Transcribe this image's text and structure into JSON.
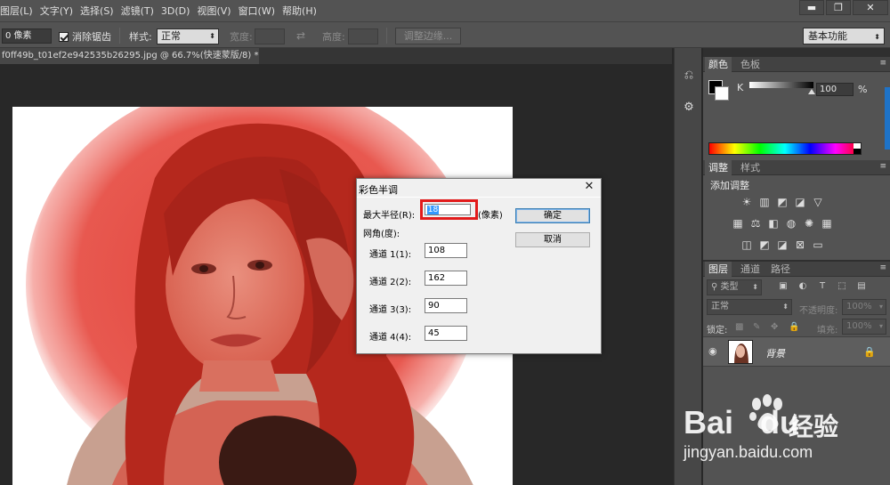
{
  "menu": [
    "图层(L)",
    "文字(Y)",
    "选择(S)",
    "滤镜(T)",
    "3D(D)",
    "视图(V)",
    "窗口(W)",
    "帮助(H)"
  ],
  "window_controls": {
    "minimize": "▬",
    "restore": "❐",
    "close": "✕"
  },
  "options": {
    "feather_value": "0 像素",
    "antialias_label": "消除锯齿",
    "antialias_checked": true,
    "style_label": "样式:",
    "style_value": "正常",
    "width_label": "宽度:",
    "height_label": "高度:",
    "refine_edge": "调整边缘...",
    "workspace": "基本功能"
  },
  "document_tab": {
    "title": "f0ff49b_t01ef2e942535b26295.jpg @ 66.7%(快速蒙版/8) *",
    "close": "×"
  },
  "color_panel": {
    "tabs": [
      "颜色",
      "色板"
    ],
    "channel_label": "K",
    "value": "100",
    "unit": "%",
    "foreground": "#000000",
    "background": "#ffffff"
  },
  "adjustments_panel": {
    "tabs": [
      "调整",
      "样式"
    ],
    "title": "添加调整"
  },
  "layers_panel": {
    "tabs": [
      "图层",
      "通道",
      "路径"
    ],
    "filter_kind": "类型",
    "blend_mode": "正常",
    "opacity_label": "不透明度:",
    "opacity_value": "100%",
    "lock_label": "锁定:",
    "fill_label": "填充:",
    "fill_value": "100%",
    "layer_name": "背景"
  },
  "dialog": {
    "title": "彩色半调",
    "max_radius_label": "最大半径(R):",
    "max_radius_value": "18",
    "radius_unit": "(像素)",
    "screen_angle_label": "网角(度):",
    "channels": [
      {
        "label": "通道 1(1):",
        "value": "108"
      },
      {
        "label": "通道 2(2):",
        "value": "162"
      },
      {
        "label": "通道 3(3):",
        "value": "90"
      },
      {
        "label": "通道 4(4):",
        "value": "45"
      }
    ],
    "ok": "确定",
    "cancel": "取消"
  },
  "watermark": {
    "brand": "Bai",
    "brand2": "du",
    "cn": "经验",
    "url": "jingyan.baidu.com"
  },
  "colors": {
    "quickmask": "#e0392f",
    "dialog_highlight": "#e21b1b",
    "selection": "#3399ff"
  }
}
